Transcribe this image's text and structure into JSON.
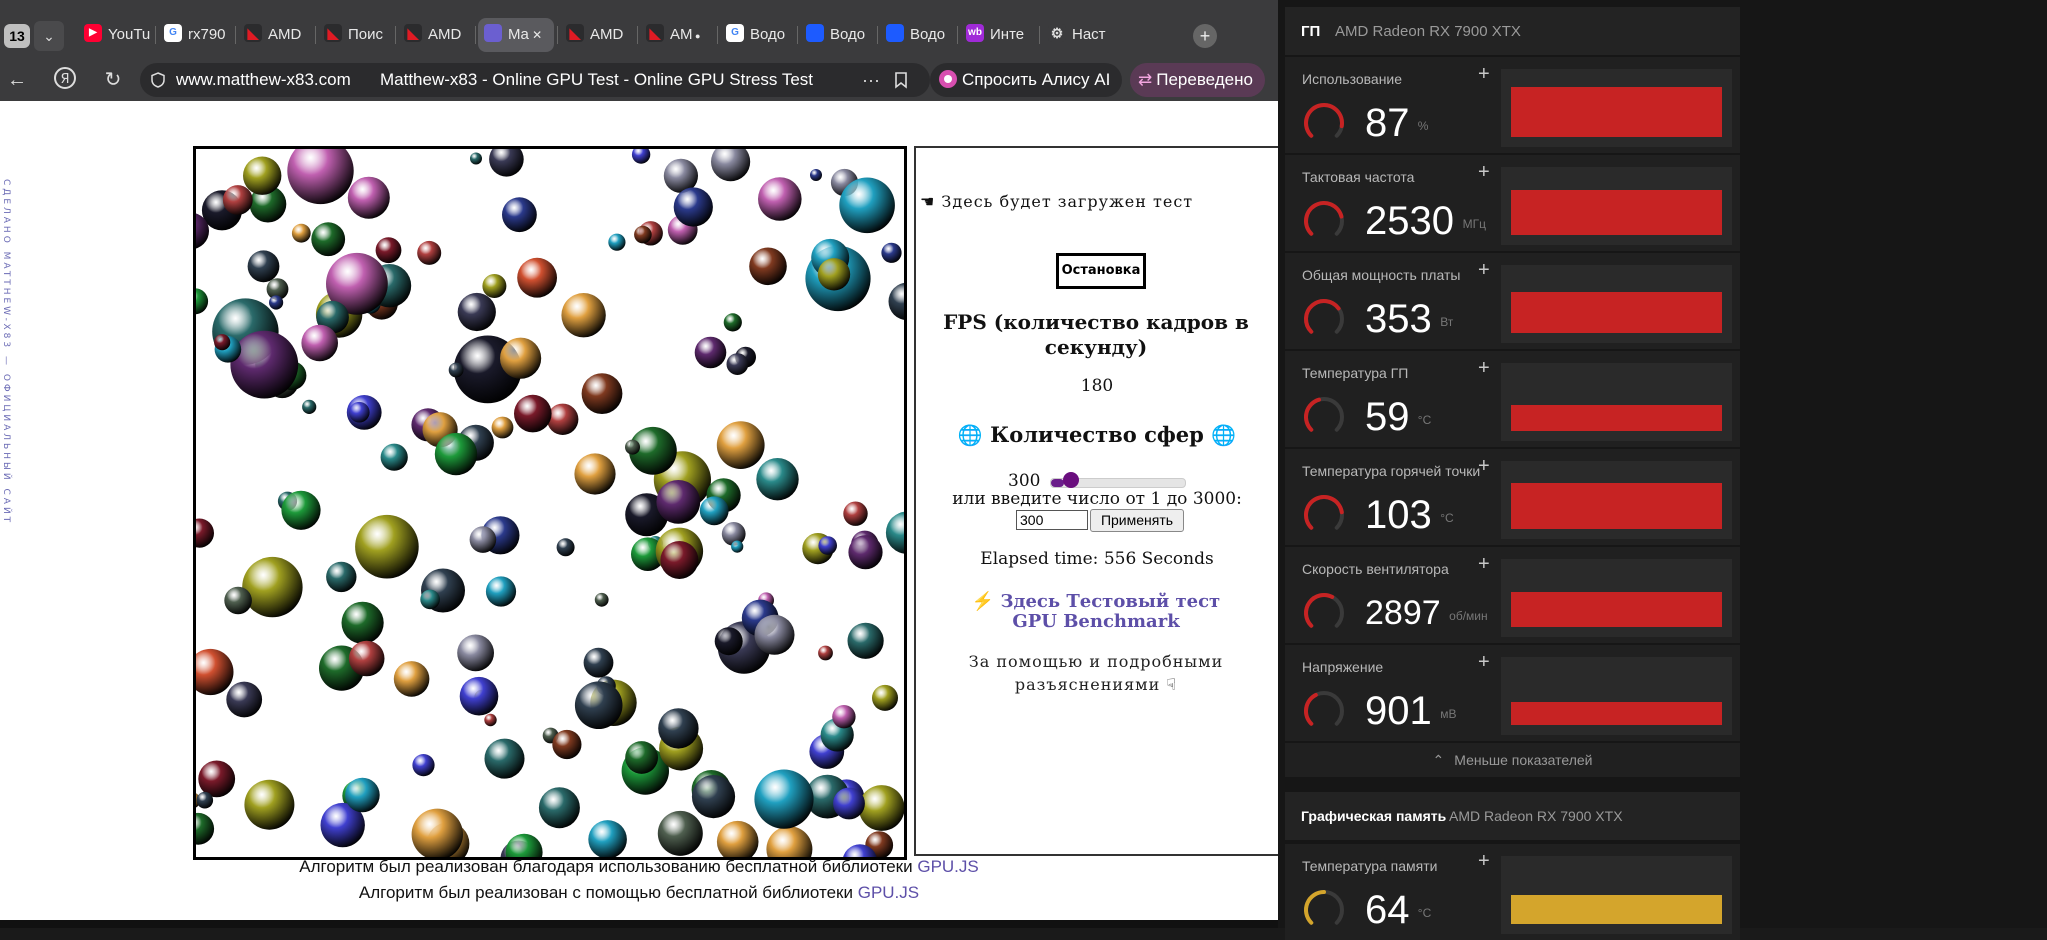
{
  "browser": {
    "tab_count": "13",
    "tabs": [
      {
        "label": "YouTu",
        "icon": "youtube-icon"
      },
      {
        "label": "rx790",
        "icon": "google-icon"
      },
      {
        "label": "AMD",
        "icon": "amd-icon"
      },
      {
        "label": "Поис",
        "icon": "amd-icon"
      },
      {
        "label": "AMD",
        "icon": "amd-icon"
      },
      {
        "label": "Ma",
        "icon": "gpu-site-icon"
      },
      {
        "label": "AMD",
        "icon": "amd-icon"
      },
      {
        "label": "AM",
        "icon": "amd-icon"
      },
      {
        "label": "Водо",
        "icon": "google-icon"
      },
      {
        "label": "Водо",
        "icon": "ozon-icon"
      },
      {
        "label": "Водо",
        "icon": "ozon-icon"
      },
      {
        "label": "Инте",
        "icon": "wb-icon"
      },
      {
        "label": "Наст",
        "icon": "gear-icon"
      }
    ],
    "url_host": "www.matthew-x83.com",
    "page_title": "Matthew-x83 - Online GPU Test - Online GPU Stress Test",
    "alice_label": "Спросить Алису AI",
    "translated_label": "Переведено"
  },
  "page": {
    "vertical_text": "СДЕЛАНО MATTHEW-X83 — ОФИЦИАЛЬНЫЙ САЙТ",
    "loaded_msg": "☚ Здесь будет загружен тест",
    "stop_label": "Остановка",
    "fps_title": "FPS (количество кадров в секунду)",
    "fps_value": "180",
    "spheres_title": "Количество сфер",
    "sphere_count": "300",
    "slider_min": 1,
    "slider_max": 3000,
    "or_text": "или введите число от 1 до 3000:",
    "input_value": "300",
    "apply_label": "Применять",
    "elapsed": "Elapsed time: 556 Seconds",
    "bench_link": "Здесь Тестовый тест GPU Benchmark",
    "help_text": "За помощью и подробными разъяснениями ☟",
    "footer_prefix_1": "Алгоритм был реализован благодаря использованию бесплатной библиотеки",
    "footer_link_1": "GPU.JS",
    "footer_prefix_2": "Алгоритм был реализован с помощью бесплатной библиотеки",
    "footer_link_2": "GPU.JS"
  },
  "amd": {
    "gpu_label": "ГП",
    "gpu_name": "AMD Radeon RX 7900 XTX",
    "metrics": [
      {
        "label": "Использование",
        "value": "87",
        "unit": "%",
        "fraction": 0.87,
        "color": "#c72323"
      },
      {
        "label": "Тактовая частота",
        "value": "2530",
        "unit": "МГц",
        "fraction": 0.78,
        "color": "#c72323"
      },
      {
        "label": "Общая мощность платы",
        "value": "353",
        "unit": "Вт",
        "fraction": 0.7,
        "color": "#c72323"
      },
      {
        "label": "Температура ГП",
        "value": "59",
        "unit": "°C",
        "fraction": 0.44,
        "color": "#c72323"
      },
      {
        "label": "Температура горячей точки",
        "value": "103",
        "unit": "°C",
        "fraction": 0.8,
        "color": "#c72323"
      },
      {
        "label": "Скорость вентилятора",
        "value": "2897",
        "unit": "об/мин",
        "fraction": 0.6,
        "color": "#c72323"
      },
      {
        "label": "Напряжение",
        "value": "901",
        "unit": "мВ",
        "fraction": 0.4,
        "color": "#c72323"
      }
    ],
    "less_label": "Меньше показателей",
    "memory_label": "Графическая память",
    "memory_gpu_name": "AMD Radeon RX 7900 XTX",
    "memory_metric": {
      "label": "Температура памяти",
      "value": "64",
      "unit": "°C",
      "fraction": 0.5,
      "color": "#d4a52c"
    }
  }
}
